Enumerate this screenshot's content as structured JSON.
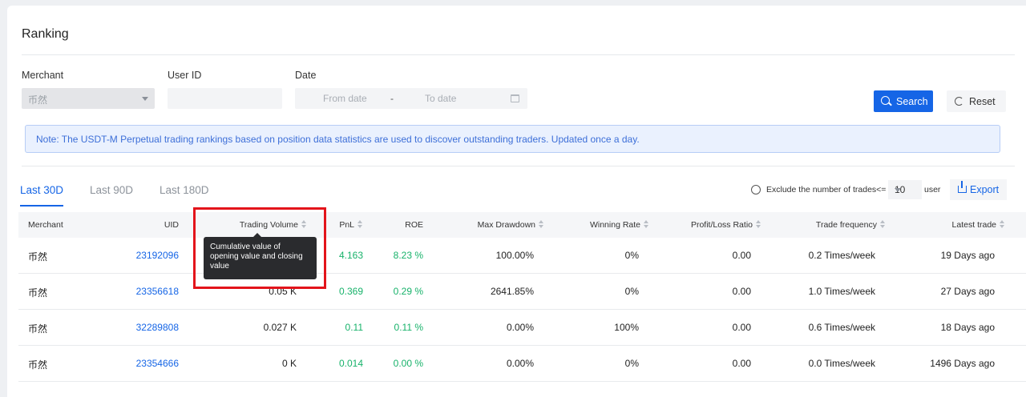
{
  "page": {
    "title": "Ranking"
  },
  "filters": {
    "merchant_label": "Merchant",
    "merchant_value": "币然",
    "user_id_label": "User ID",
    "user_id_value": "",
    "date_label": "Date",
    "from_placeholder": "From date",
    "separator": "-",
    "to_placeholder": "To date",
    "search_label": "Search",
    "reset_label": "Reset"
  },
  "note": "Note: The USDT-M Perpetual trading rankings based on position data statistics are used to discover outstanding traders. Updated once a day.",
  "tabs": [
    {
      "label": "Last 30D",
      "active": true
    },
    {
      "label": "Last 90D",
      "active": false
    },
    {
      "label": "Last 180D",
      "active": false
    }
  ],
  "toolbar": {
    "exclude_label": "Exclude the number of trades<=",
    "exclude_value": "10",
    "user_label": "user",
    "export_label": "Export"
  },
  "table": {
    "columns": [
      "Merchant",
      "UID",
      "Trading Volume",
      "PnL",
      "ROE",
      "Max Drawdown",
      "Winning Rate",
      "Profit/Loss Ratio",
      "Trade frequency",
      "Latest trade"
    ],
    "rows": [
      [
        "币然",
        "23192096",
        "",
        "4.163",
        "8.23 %",
        "100.00%",
        "0%",
        "0.00",
        "0.2 Times/week",
        "19 Days ago"
      ],
      [
        "币然",
        "23356618",
        "0.05 K",
        "0.369",
        "0.29 %",
        "2641.85%",
        "0%",
        "0.00",
        "1.0 Times/week",
        "27 Days ago"
      ],
      [
        "币然",
        "32289808",
        "0.027 K",
        "0.11",
        "0.11 %",
        "0.00%",
        "100%",
        "0.00",
        "0.6 Times/week",
        "18 Days ago"
      ],
      [
        "币然",
        "23354666",
        "0 K",
        "0.014",
        "0.00 %",
        "0.00%",
        "0%",
        "0.00",
        "0.0 Times/week",
        "1496 Days ago"
      ]
    ]
  },
  "tooltip": "Cumulative value of opening value and closing value",
  "colors": {
    "primary": "#1565e6",
    "positive": "#17b26a",
    "highlight": "#e3141b"
  }
}
